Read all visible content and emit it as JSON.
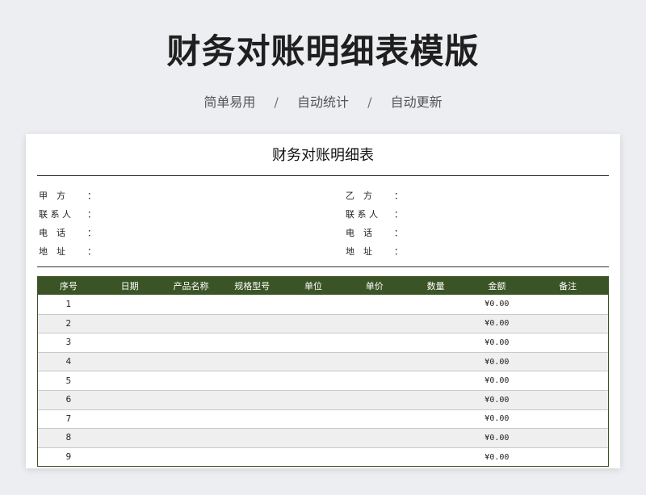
{
  "hero": {
    "title": "财务对账明细表模版",
    "tags": [
      "简单易用",
      "自动统计",
      "自动更新"
    ],
    "separator": "/"
  },
  "document": {
    "title": "财务对账明细表",
    "party_a": {
      "fields": [
        {
          "label": "甲　方",
          "colon": "："
        },
        {
          "label": "联 系 人",
          "colon": "："
        },
        {
          "label": "电　话",
          "colon": "："
        },
        {
          "label": "地　址",
          "colon": "："
        }
      ]
    },
    "party_b": {
      "fields": [
        {
          "label": "乙　方",
          "colon": "："
        },
        {
          "label": "联 系 人",
          "colon": "："
        },
        {
          "label": "电　话",
          "colon": "："
        },
        {
          "label": "地　址",
          "colon": "："
        }
      ]
    }
  },
  "table": {
    "headers": [
      "序号",
      "日期",
      "产品名称",
      "规格型号",
      "单位",
      "单价",
      "数量",
      "金额",
      "备注"
    ],
    "rows": [
      {
        "no": "1",
        "amount": "¥0.00"
      },
      {
        "no": "2",
        "amount": "¥0.00"
      },
      {
        "no": "3",
        "amount": "¥0.00"
      },
      {
        "no": "4",
        "amount": "¥0.00"
      },
      {
        "no": "5",
        "amount": "¥0.00"
      },
      {
        "no": "6",
        "amount": "¥0.00"
      },
      {
        "no": "7",
        "amount": "¥0.00"
      },
      {
        "no": "8",
        "amount": "¥0.00"
      },
      {
        "no": "9",
        "amount": "¥0.00"
      }
    ]
  },
  "colors": {
    "header_bg": "#3a5426",
    "alt_row": "#efefef",
    "page_bg": "#eceef2"
  }
}
